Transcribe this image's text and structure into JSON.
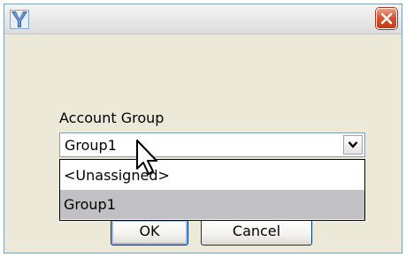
{
  "dialog": {
    "app_icon": "y-logo-icon",
    "close_icon": "close-x-icon"
  },
  "account_group": {
    "label": "Account Group",
    "selected": "Group1",
    "arrow_icon": "chevron-down-icon",
    "options": [
      "<Unassigned>",
      "Group1"
    ],
    "highlighted_option": "Group1"
  },
  "buttons": {
    "ok_label": "OK",
    "cancel_label": "Cancel"
  },
  "cursor_icon": "mouse-pointer-icon",
  "colors": {
    "dialog_bg": "#ece9d8",
    "close_red": "#d9552f",
    "list_highlight": "#c1c1c5",
    "app_icon_blue": "#3a67a8"
  }
}
